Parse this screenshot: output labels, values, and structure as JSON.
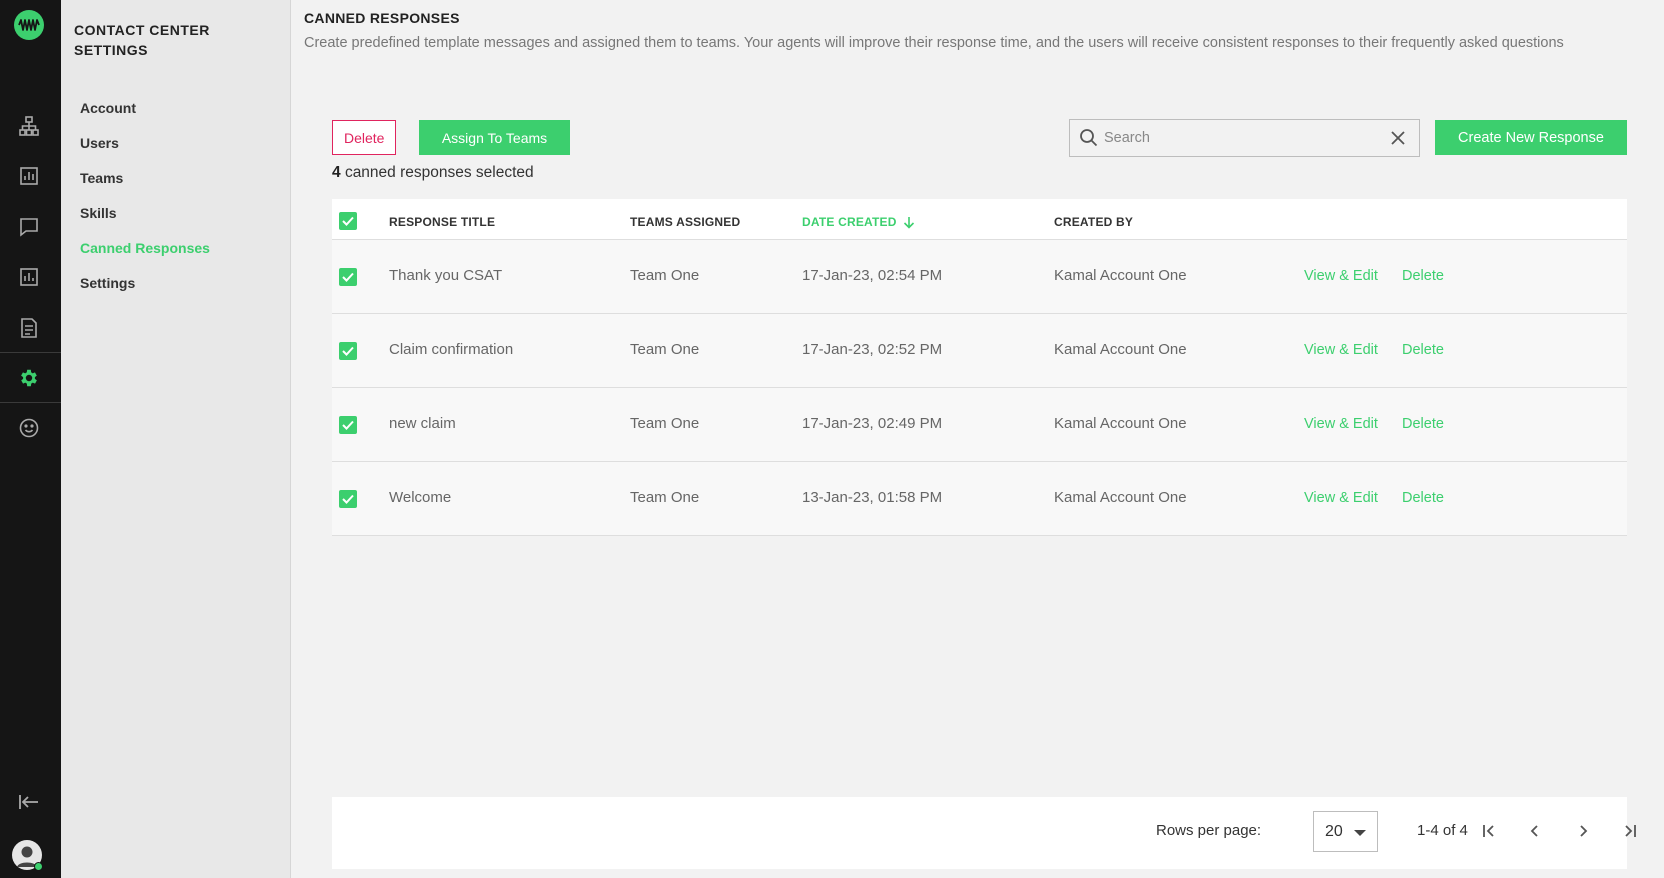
{
  "app": {
    "logo_icon": "logo-waveform",
    "accent_color": "#3ccf6e",
    "danger_color": "#e0245e"
  },
  "rail": {
    "icons": [
      "org-chart-icon",
      "bar-chart-icon",
      "chat-icon",
      "analytics-icon",
      "document-icon",
      "gear-icon",
      "smiley-icon",
      "logout-icon",
      "user-avatar-icon"
    ],
    "active": "gear-icon"
  },
  "nav": {
    "title": "CONTACT CENTER SETTINGS",
    "items": [
      {
        "label": "Account"
      },
      {
        "label": "Users"
      },
      {
        "label": "Teams"
      },
      {
        "label": "Skills"
      },
      {
        "label": "Canned Responses"
      },
      {
        "label": "Settings"
      }
    ],
    "active_item": "Canned Responses"
  },
  "page": {
    "title": "CANNED RESPONSES",
    "description": "Create predefined template messages and assigned them to teams. Your agents will improve their response time, and the users will receive consistent responses to their frequently asked questions"
  },
  "toolbar": {
    "delete_label": "Delete",
    "assign_label": "Assign To Teams",
    "selected_count": "4",
    "selected_text": "canned responses selected",
    "search_placeholder": "Search",
    "search_value": "",
    "create_label": "Create New Response"
  },
  "table": {
    "columns": [
      "RESPONSE TITLE",
      "TEAMS ASSIGNED",
      "DATE CREATED",
      "CREATED BY"
    ],
    "sort_column": "DATE CREATED",
    "sort_direction": "descending",
    "rows": [
      {
        "title": "Thank you CSAT",
        "team": "Team One",
        "date": "17-Jan-23, 02:54 PM",
        "created_by": "Kamal Account One",
        "view_label": "View & Edit",
        "delete_label": "Delete",
        "checked": true
      },
      {
        "title": "Claim confirmation",
        "team": "Team One",
        "date": "17-Jan-23, 02:52 PM",
        "created_by": "Kamal Account One",
        "view_label": "View & Edit",
        "delete_label": "Delete",
        "checked": true
      },
      {
        "title": "new claim",
        "team": "Team One",
        "date": "17-Jan-23, 02:49 PM",
        "created_by": "Kamal Account One",
        "view_label": "View & Edit",
        "delete_label": "Delete",
        "checked": true
      },
      {
        "title": "Welcome",
        "team": "Team One",
        "date": "13-Jan-23, 01:58 PM",
        "created_by": "Kamal Account One",
        "view_label": "View & Edit",
        "delete_label": "Delete",
        "checked": true
      }
    ]
  },
  "pagination": {
    "rows_per_page_label": "Rows per page:",
    "rows_per_page_value": "20",
    "range_text": "1-4 of 4"
  }
}
